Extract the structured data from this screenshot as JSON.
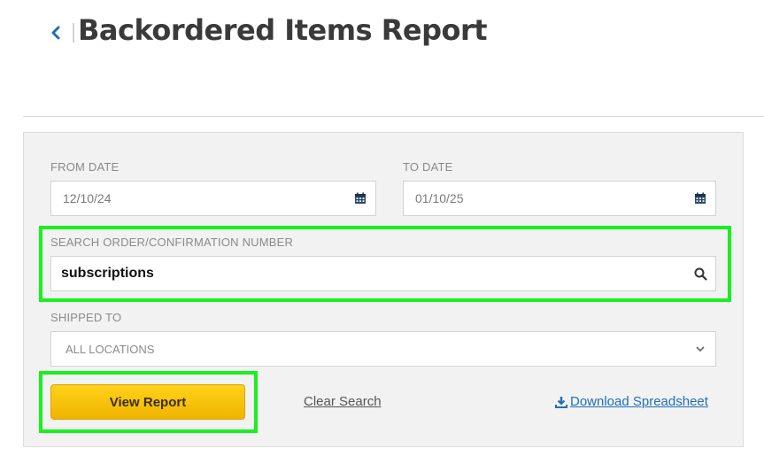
{
  "header": {
    "title": "Backordered Items Report",
    "back_icon": "chevron-left-icon"
  },
  "filters": {
    "from_date": {
      "label": "FROM DATE",
      "value": "12/10/24",
      "icon": "calendar-icon"
    },
    "to_date": {
      "label": "TO DATE",
      "value": "01/10/25",
      "icon": "calendar-icon"
    },
    "search": {
      "label": "SEARCH ORDER/CONFIRMATION NUMBER",
      "value": "subscriptions",
      "icon": "search-icon"
    },
    "shipped_to": {
      "label": "SHIPPED TO",
      "selected": "ALL LOCATIONS",
      "icon": "chevron-down-icon"
    }
  },
  "actions": {
    "view_report_label": "View Report",
    "clear_search_label": "Clear Search",
    "download_label": "Download Spreadsheet",
    "download_icon": "download-icon"
  },
  "colors": {
    "accent_yellow": "#f5c000",
    "link_blue": "#1f6fb8",
    "highlight_green": "#19f01f",
    "icon_navy": "#2a4a6b"
  }
}
